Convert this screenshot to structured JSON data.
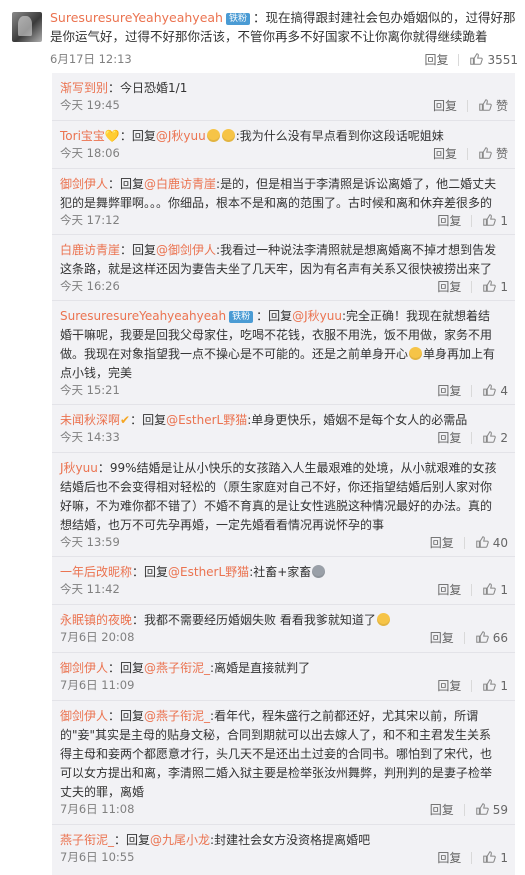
{
  "top": {
    "username": "SuresuresureYeahyeahyeah",
    "badge": "铁粉",
    "text": "：现在搞得跟封建社会包办婚姻似的，过得好那是你运气好，过得不好那你活该，不管你再多不好国家不让你离你就得继续跪着",
    "time": "6月17日 12:13",
    "reply_label": "回复",
    "likes": "3551"
  },
  "replies": [
    {
      "user": "渐写到别",
      "text": "：今日恐婚1/1",
      "time": "今天 19:45",
      "reply_label": "回复",
      "likes": "赞"
    },
    {
      "user": "Tori宝宝",
      "reply_prefix": "：回复",
      "target": "@J秋yuu",
      "text": ":我为什么没有早点看到你这段话呢姐妹",
      "time": "今天 18:06",
      "reply_label": "回复",
      "likes": "赞"
    },
    {
      "user": "御剑伊人",
      "reply_prefix": "：回复",
      "target": "@白鹿访青崖",
      "text": ":是的，但是相当于李清照是诉讼离婚了，他二婚丈夫犯的是舞弊罪啊。。。你细品，根本不是和离的范围了。古时候和离和休弃差很多的",
      "time": "今天 17:12",
      "reply_label": "回复",
      "likes": "1"
    },
    {
      "user": "白鹿访青崖",
      "reply_prefix": "：回复",
      "target": "@御剑伊人",
      "text": ":我看过一种说法李清照就是想离婚离不掉才想到告发这条路，就是这样还因为妻告夫坐了几天牢，因为有名声有关系又很快被捞出来了",
      "time": "今天 16:26",
      "reply_label": "回复",
      "likes": "1"
    },
    {
      "user": "SuresuresureYeahyeahyeah",
      "badge": "铁粉",
      "reply_prefix": "：回复",
      "target": "@J秋yuu",
      "text": ":完全正确！我现在就想着结婚干嘛呢，我要是回我父母家住，吃喝不花钱，衣服不用洗，饭不用做，家务不用做。我现在对象指望我一点不操心是不可能的。还是之前单身开心",
      "text2": "单身再加上有点小钱，完美",
      "time": "今天 15:21",
      "reply_label": "回复",
      "likes": "4"
    },
    {
      "user": "未闻秋深啊",
      "reply_prefix": "：回复",
      "target": "@EstherL野猫",
      "text": ":单身更快乐，婚姻不是每个女人的必需品",
      "time": "今天 14:33",
      "reply_label": "回复",
      "likes": "2"
    },
    {
      "user": "J秋yuu",
      "text": "：99%结婚是让从小快乐的女孩踏入人生最艰难的处境，从小就艰难的女孩结婚后也不会变得相对轻松的（原生家庭对自己不好，你还指望结婚后别人家对你好嘛，不为难你都不错了）不婚不育真的是让女性逃脱这种情况最好的办法。真的想结婚，也万不可先孕再婚，一定先婚看看情况再说怀孕的事",
      "time": "今天 13:59",
      "reply_label": "回复",
      "likes": "40"
    },
    {
      "user": "一年后改昵称",
      "reply_prefix": "：回复",
      "target": "@EstherL野猫",
      "text": ":社畜+家畜",
      "time": "今天 11:42",
      "reply_label": "回复",
      "likes": "1"
    },
    {
      "user": "永眠镇的夜晚",
      "text": "：我都不需要经历婚姻失败 看看我爹就知道了",
      "time": "7月6日 20:08",
      "reply_label": "回复",
      "likes": "66"
    },
    {
      "user": "御剑伊人",
      "reply_prefix": "：回复",
      "target": "@燕子衔泥_",
      "text": ":离婚是直接就判了",
      "time": "7月6日 11:09",
      "reply_label": "回复",
      "likes": "1"
    },
    {
      "user": "御剑伊人",
      "reply_prefix": "：回复",
      "target": "@燕子衔泥_",
      "text": ":看年代，程朱盛行之前都还好，尤其宋以前，所谓的\"妾\"其实是主母的贴身文秘，合同到期就可以出去嫁人了，和不和主君发生关系得主母和妾两个都愿意才行，头几天不是还出土过妾的合同书。哪怕到了宋代，也可以女方提出和离，李清照二婚入狱主要是检举张汝州舞弊，判刑判的是妻子检举丈夫的罪，离婚",
      "time": "7月6日 11:08",
      "reply_label": "回复",
      "likes": "59"
    },
    {
      "user": "燕子衔泥_",
      "reply_prefix": "：回复",
      "target": "@九尾小龙",
      "text": ":封建社会女方没资格提离婚吧",
      "time": "7月6日 10:55",
      "reply_label": "回复",
      "likes": "1"
    }
  ]
}
